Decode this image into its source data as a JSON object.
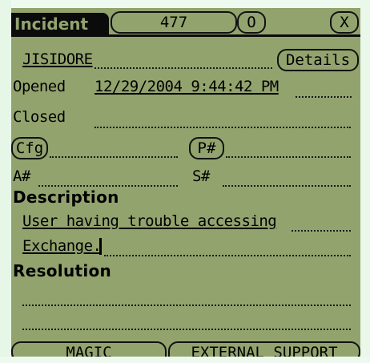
{
  "header": {
    "title": "Incident",
    "incident_number": "477",
    "option_label": "O",
    "close_label": "X"
  },
  "contact": {
    "name": "JISIDORE",
    "details_label": "Details"
  },
  "opened": {
    "label": "Opened",
    "value": "12/29/2004 9:44:42 PM"
  },
  "closed": {
    "label": "Closed",
    "value": ""
  },
  "cfg": {
    "label": "Cfg"
  },
  "p_number": {
    "label": "P#"
  },
  "a_number": {
    "label": "A#"
  },
  "s_number": {
    "label": "S#"
  },
  "description": {
    "heading": "Description",
    "line1": "User having trouble accessing",
    "line2": "Exchange."
  },
  "resolution": {
    "heading": "Resolution",
    "line1": "",
    "line2": ""
  },
  "footer": {
    "magic_label": "MAGIC",
    "external_label": "EXTERNAL_SUPPORT"
  },
  "colors": {
    "screen_background": "#93a36e",
    "ink": "#000000"
  }
}
